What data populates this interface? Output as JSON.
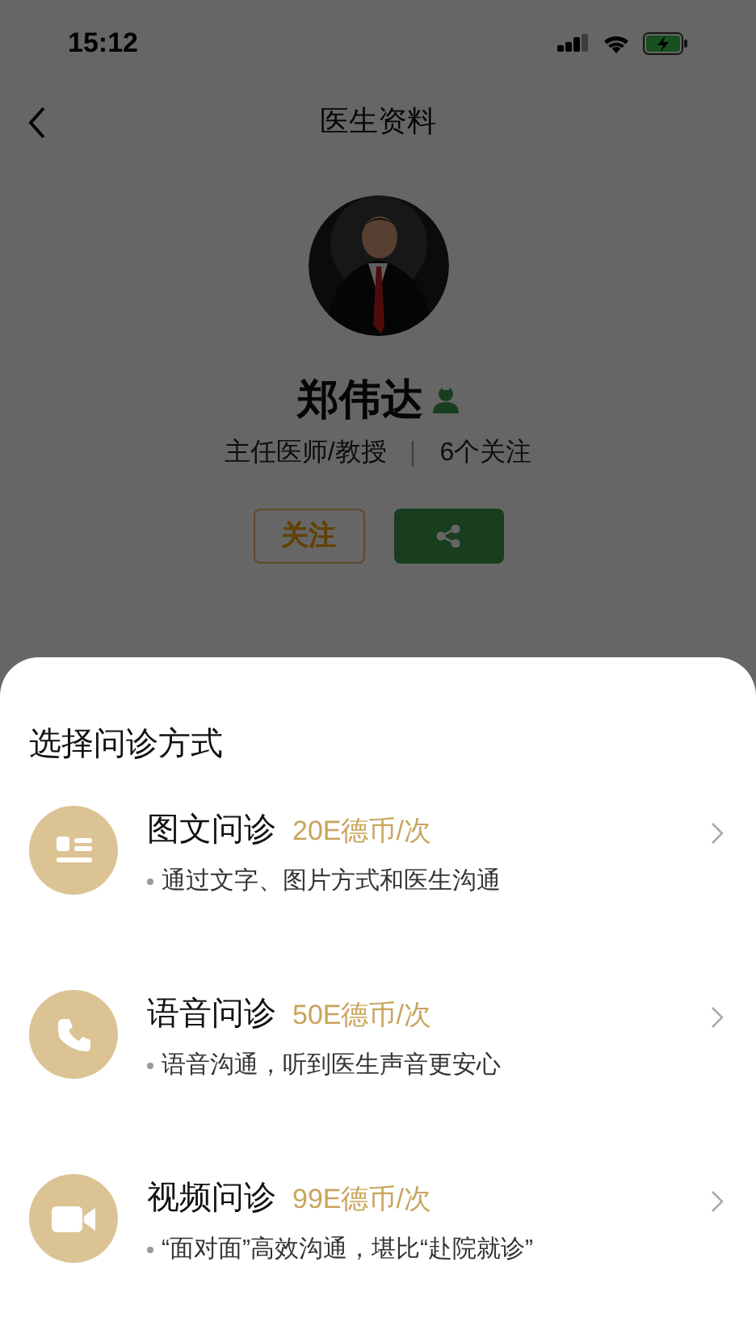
{
  "status_bar": {
    "time": "15:12"
  },
  "nav": {
    "title": "医生资料"
  },
  "doctor": {
    "name": "郑伟达",
    "title": "主任医师/教授",
    "followers": "6个关注"
  },
  "actions": {
    "follow": "关注"
  },
  "sheet": {
    "title": "选择问诊方式",
    "options": [
      {
        "kind": "text",
        "name": "图文问诊",
        "price": "20E德币/次",
        "description": "通过文字、图片方式和医生沟通"
      },
      {
        "kind": "voice",
        "name": "语音问诊",
        "price": "50E德币/次",
        "description": "语音沟通，听到医生声音更安心"
      },
      {
        "kind": "video",
        "name": "视频问诊",
        "price": "99E德币/次",
        "description": "“面对面”高效沟通，堪比“赴院就诊”"
      }
    ]
  }
}
